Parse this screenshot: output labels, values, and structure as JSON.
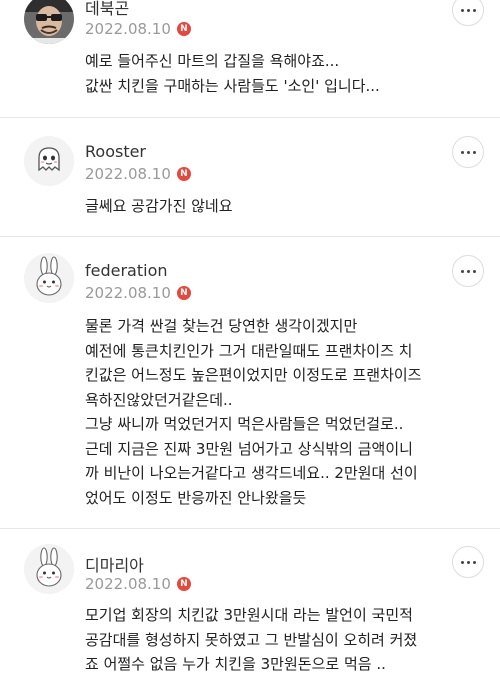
{
  "comments": [
    {
      "username": "데북곤",
      "date": "2022.08.10",
      "badge": "N",
      "avatar": "person-photo-avatar",
      "lines": [
        "예로 들어주신 마트의 갑질을 욕해야죠...",
        "값싼 치킨을 구매하는 사람들도 '소인' 입니다..."
      ]
    },
    {
      "username": "Rooster",
      "date": "2022.08.10",
      "badge": "N",
      "avatar": "ghost-character-avatar",
      "lines": [
        "글쎄요 공감가진 않네요"
      ]
    },
    {
      "username": "federation",
      "date": "2022.08.10",
      "badge": "N",
      "avatar": "rabbit-character-avatar",
      "lines": [
        "물론 가격 싼걸 찾는건 당연한 생각이겠지만",
        "예전에 통큰치킨인가 그거 대란일때도 프랜차이즈 치",
        "킨값은 어느정도 높은편이었지만 이정도로 프랜차이즈",
        "욕하진않았던거같은데..",
        "그냥 싸니까 먹었던거지 먹은사람들은 먹었던걸로..",
        "근데 지금은 진짜 3만원 넘어가고 상식밖의 금액이니",
        "까 비난이 나오는거같다고 생각드네요.. 2만원대 선이",
        "었어도 이정도 반응까진 안나왔을듯"
      ]
    },
    {
      "username": "디마리아",
      "date": "2022.08.10",
      "badge": "N",
      "avatar": "rabbit-character-avatar",
      "lines": [
        "모기업 회장의 치킨값 3만원시대 라는 발언이 국민적",
        "공감대를 형성하지 못하였고 그 반발심이 오히려 커졌",
        "죠 어쩔수 없음 누가 치킨을 3만원돈으로 먹음 .."
      ]
    }
  ],
  "colors": {
    "badge": "#e8473c",
    "date": "#9a9a9a",
    "text": "#222222",
    "divider": "#e6e6e6"
  }
}
